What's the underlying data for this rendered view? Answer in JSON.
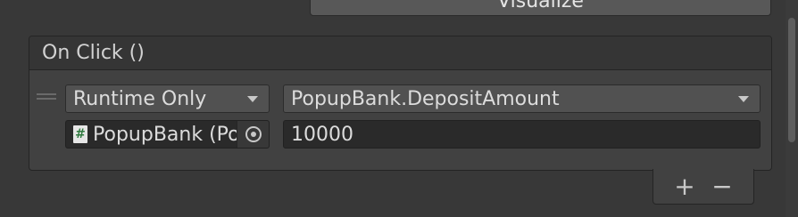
{
  "header_button": {
    "label": "Visualize"
  },
  "event": {
    "title": "On Click ()",
    "listener": {
      "call_state": "Runtime Only",
      "method": "PopupBank.DepositAmount",
      "target_object": "PopupBank (Po",
      "target_icon": "#",
      "argument_value": "10000"
    }
  },
  "footer": {
    "add_label": "+",
    "remove_label": "−"
  },
  "colors": {
    "background": "#383838",
    "panel": "#414141",
    "header": "#353535",
    "field_dark": "#2a2a2a",
    "dropdown": "#515151"
  }
}
